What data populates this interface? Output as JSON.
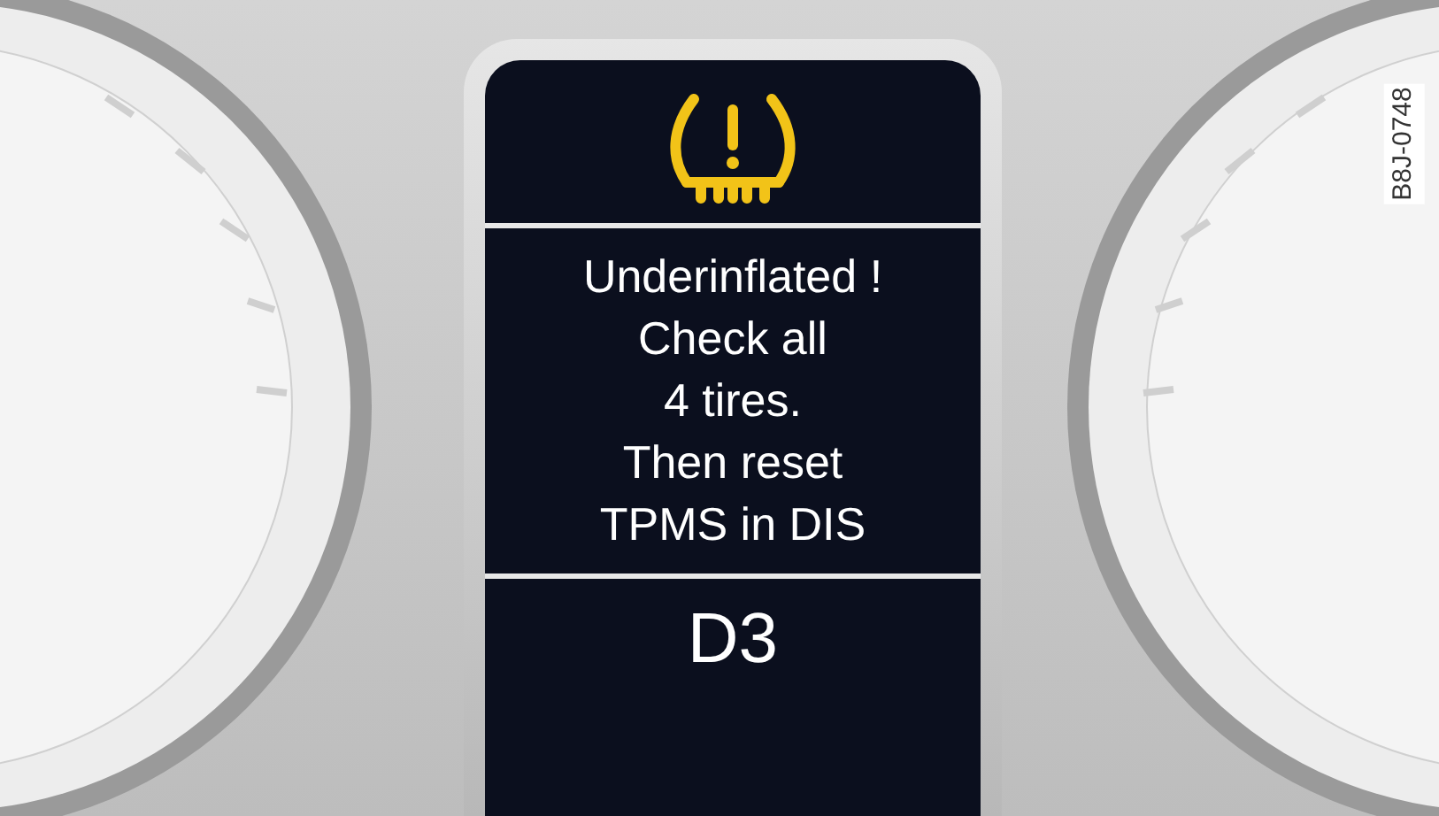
{
  "display": {
    "message_lines": [
      "Underinflated !",
      "Check all",
      "4 tires.",
      "Then reset",
      "TPMS in DIS"
    ],
    "gear": "D3"
  },
  "figure_code": "B8J-0748"
}
